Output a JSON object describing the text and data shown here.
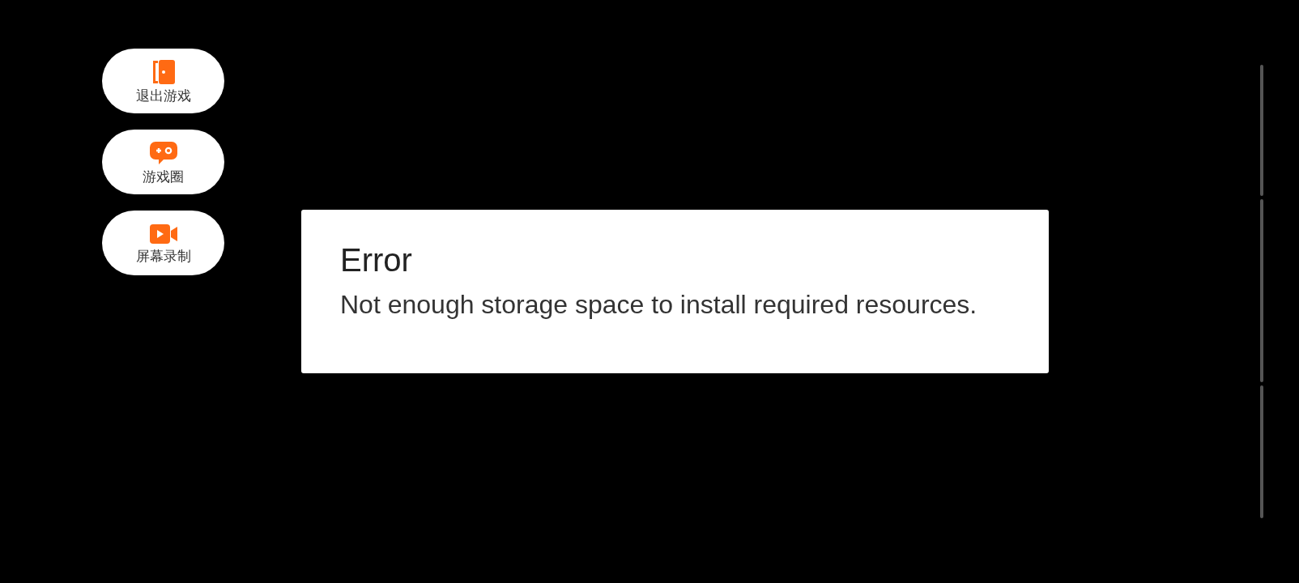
{
  "side_menu": [
    {
      "label": "退出游戏"
    },
    {
      "label": "游戏圈"
    },
    {
      "label": "屏幕录制"
    }
  ],
  "dialog": {
    "title": "Error",
    "message": "Not enough storage space to install required resources."
  }
}
